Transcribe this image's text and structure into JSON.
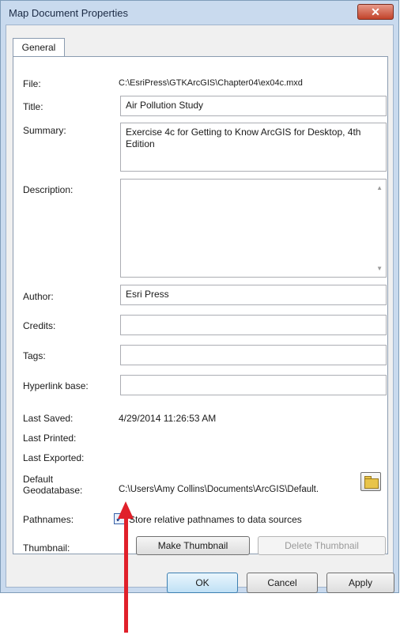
{
  "window": {
    "title": "Map Document Properties",
    "close_glyph": "✕"
  },
  "tabs": [
    {
      "label": "General"
    }
  ],
  "fields": {
    "file": {
      "label": "File:",
      "value": "C:\\EsriPress\\GTKArcGIS\\Chapter04\\ex04c.mxd"
    },
    "title": {
      "label": "Title:",
      "value": "Air Pollution Study"
    },
    "summary": {
      "label": "Summary:",
      "value": "Exercise 4c for Getting to Know ArcGIS for Desktop, 4th Edition"
    },
    "description": {
      "label": "Description:",
      "value": ""
    },
    "author": {
      "label": "Author:",
      "value": "Esri Press"
    },
    "credits": {
      "label": "Credits:",
      "value": ""
    },
    "tags": {
      "label": "Tags:",
      "value": ""
    },
    "hyperlink_base": {
      "label": "Hyperlink base:",
      "value": ""
    },
    "last_saved": {
      "label": "Last Saved:",
      "value": "4/29/2014 11:26:53 AM"
    },
    "last_printed": {
      "label": "Last Printed:",
      "value": ""
    },
    "last_exported": {
      "label": "Last Exported:",
      "value": ""
    },
    "default_gdb": {
      "label_line1": "Default",
      "label_line2": "Geodatabase:",
      "value": "C:\\Users\\Amy Collins\\Documents\\ArcGIS\\Default."
    },
    "pathnames": {
      "label": "Pathnames:",
      "checkbox_label": "Store relative pathnames to data sources",
      "checked": true
    },
    "thumbnail": {
      "label": "Thumbnail:"
    }
  },
  "buttons": {
    "make_thumbnail": "Make Thumbnail",
    "delete_thumbnail": "Delete Thumbnail",
    "ok": "OK",
    "cancel": "Cancel",
    "apply": "Apply"
  },
  "icons": {
    "close": "close-icon",
    "browse": "folder-browse-icon",
    "checkmark": "checkmark-icon",
    "annotation_arrow": "red-up-arrow-icon"
  },
  "colors": {
    "annotation_arrow": "#e0202a",
    "title_bar": "#c9daee",
    "close_button": "#c2432a"
  }
}
